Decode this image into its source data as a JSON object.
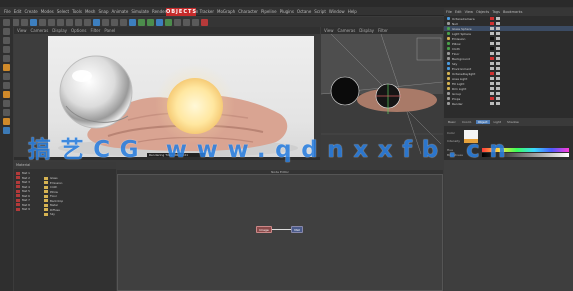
{
  "window": {
    "title": "CINEMA 4D R20"
  },
  "menu": {
    "items": [
      "File",
      "Edit",
      "Create",
      "Modes",
      "Select",
      "Tools",
      "Mesh",
      "Snap",
      "Animate",
      "Simulate",
      "Render",
      "Sculpt",
      "Motion Tracker",
      "MoGraph",
      "Character",
      "Pipeline",
      "Plugins",
      "Octane",
      "Script",
      "Window",
      "Help"
    ]
  },
  "mode_badge": "OBJECTS",
  "viewport_main": {
    "menu": [
      "View",
      "Cameras",
      "Display",
      "Options",
      "Filter",
      "Panel"
    ],
    "status_text": "Rendering Time: 00:00:21"
  },
  "viewport_side": {
    "menu": [
      "View",
      "Cameras",
      "Display",
      "Filter"
    ]
  },
  "object_manager": {
    "tabs": [
      "File",
      "Edit",
      "View",
      "Objects",
      "Tags",
      "Bookmarks"
    ],
    "rows": [
      {
        "label": "OctaneCamera",
        "dot": "#4a9be0",
        "tag": "red"
      },
      {
        "label": "Null",
        "dot": "#9a9a9a",
        "tag": "red"
      },
      {
        "label": "Glass Sphere",
        "dot": "#4aa04a",
        "tag": "grey"
      },
      {
        "label": "Light Sphere",
        "dot": "#4aa04a",
        "tag": "grey"
      },
      {
        "label": "Emission",
        "dot": "#d6b352",
        "tag": "blk"
      },
      {
        "label": "Pillow",
        "dot": "#4aa04a",
        "tag": "grey"
      },
      {
        "label": "Cloth",
        "dot": "#4aa04a",
        "tag": "blk"
      },
      {
        "label": "Floor",
        "dot": "#9a9a9a",
        "tag": "grey"
      },
      {
        "label": "Background",
        "dot": "#9a9a9a",
        "tag": "red"
      },
      {
        "label": "Sky",
        "dot": "#4a9be0",
        "tag": "grey"
      },
      {
        "label": "Environment",
        "dot": "#4a9be0",
        "tag": "grey"
      },
      {
        "label": "OctaneDaylight",
        "dot": "#d6b352",
        "tag": "red"
      },
      {
        "label": "Area Light",
        "dot": "#d6b352",
        "tag": "grey"
      },
      {
        "label": "Fill Light",
        "dot": "#d6b352",
        "tag": "grey"
      },
      {
        "label": "Rim Light",
        "dot": "#d6b352",
        "tag": "grey"
      },
      {
        "label": "Group",
        "dot": "#9a9a9a",
        "tag": "grey"
      },
      {
        "label": "Props",
        "dot": "#9a9a9a",
        "tag": "red"
      },
      {
        "label": "Render",
        "dot": "#9a9a9a",
        "tag": "grey"
      }
    ]
  },
  "attribute_manager": {
    "tabs": [
      "Basic",
      "Coord.",
      "Object",
      "Light",
      "Shadow"
    ],
    "active_tab": "Object",
    "labels": [
      "Color",
      "Intensity",
      "Hue",
      "Brightness"
    ]
  },
  "material_panel": {
    "title": "Material",
    "left_items": [
      "Mat 1",
      "Mat 2",
      "Mat 3",
      "Mat 4",
      "Mat 5",
      "Mat 6",
      "Mat 7",
      "Mat 8",
      "Mat 9"
    ],
    "items": [
      "Glass",
      "Emission",
      "Cloth",
      "Pillow",
      "Floor",
      "Backdrop",
      "Metal",
      "Diffuse",
      "Sky"
    ]
  },
  "node_editor": {
    "title": "Node Editor",
    "node_a": "Image",
    "node_b": "Mat"
  },
  "watermark": "搞艺CG www.qdnxxfb.cn",
  "colors": {
    "accent": "#3d7fbf",
    "record": "#c62b2b",
    "watermark": "#2a7fe0"
  }
}
